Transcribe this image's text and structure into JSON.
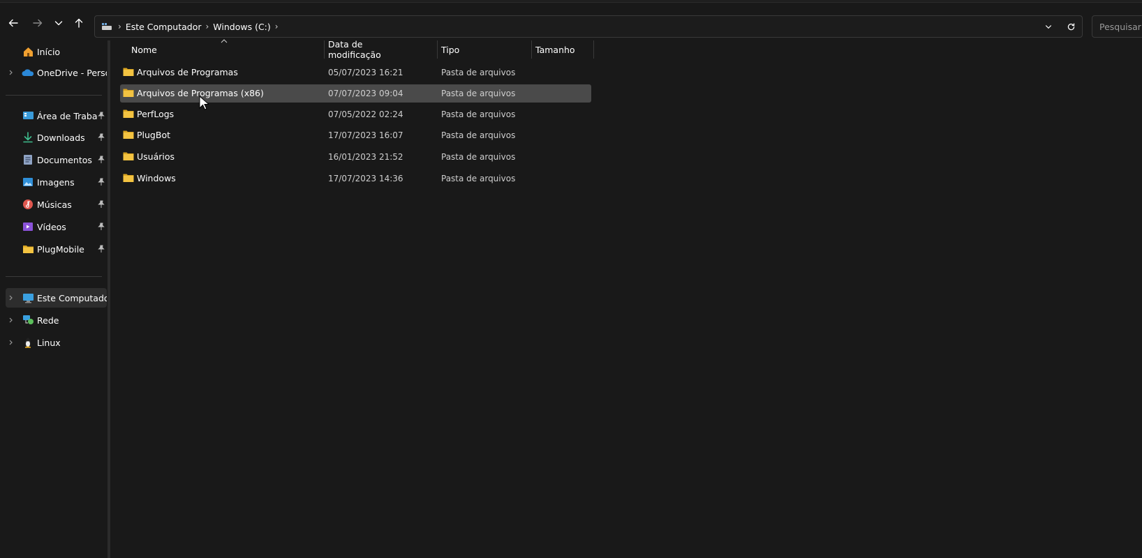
{
  "toolbar": {
    "back_icon": "arrow-left-icon",
    "forward_icon": "arrow-right-icon",
    "recent_icon": "chevron-down-icon",
    "up_icon": "arrow-up-icon"
  },
  "address": {
    "crumbs": [
      "Este Computador",
      "Windows (C:)"
    ],
    "dropdown_icon": "chevron-down-icon",
    "refresh_icon": "refresh-icon"
  },
  "search": {
    "placeholder": "Pesquisar em"
  },
  "sidebar": {
    "items": [
      {
        "label": "Início",
        "icon": "home-icon"
      },
      {
        "label": "OneDrive - Persona",
        "icon": "cloud-icon"
      },
      {
        "label": "Área de Trabalho",
        "icon": "desktop-icon"
      },
      {
        "label": "Downloads",
        "icon": "download-icon"
      },
      {
        "label": "Documentos",
        "icon": "document-icon"
      },
      {
        "label": "Imagens",
        "icon": "image-icon"
      },
      {
        "label": "Músicas",
        "icon": "music-icon"
      },
      {
        "label": "Vídeos",
        "icon": "video-icon"
      },
      {
        "label": "PlugMobile",
        "icon": "folder-icon"
      },
      {
        "label": "Este Computador",
        "icon": "computer-icon"
      },
      {
        "label": "Rede",
        "icon": "network-icon"
      },
      {
        "label": "Linux",
        "icon": "linux-icon"
      }
    ]
  },
  "columns": {
    "name": "Nome",
    "date": "Data de modificação",
    "type": "Tipo",
    "size": "Tamanho"
  },
  "files": [
    {
      "name": "Arquivos de Programas",
      "date": "05/07/2023 16:21",
      "type": "Pasta de arquivos"
    },
    {
      "name": "Arquivos de Programas (x86)",
      "date": "07/07/2023 09:04",
      "type": "Pasta de arquivos"
    },
    {
      "name": "PerfLogs",
      "date": "07/05/2022 02:24",
      "type": "Pasta de arquivos"
    },
    {
      "name": "PlugBot",
      "date": "17/07/2023 16:07",
      "type": "Pasta de arquivos"
    },
    {
      "name": "Usuários",
      "date": "16/01/2023 21:52",
      "type": "Pasta de arquivos"
    },
    {
      "name": "Windows",
      "date": "17/07/2023 14:36",
      "type": "Pasta de arquivos"
    }
  ],
  "colors": {
    "background": "#191919",
    "hover_row": "#4a4a4a",
    "selected_nav": "#2d2d2d",
    "folder": "#f3c341"
  }
}
